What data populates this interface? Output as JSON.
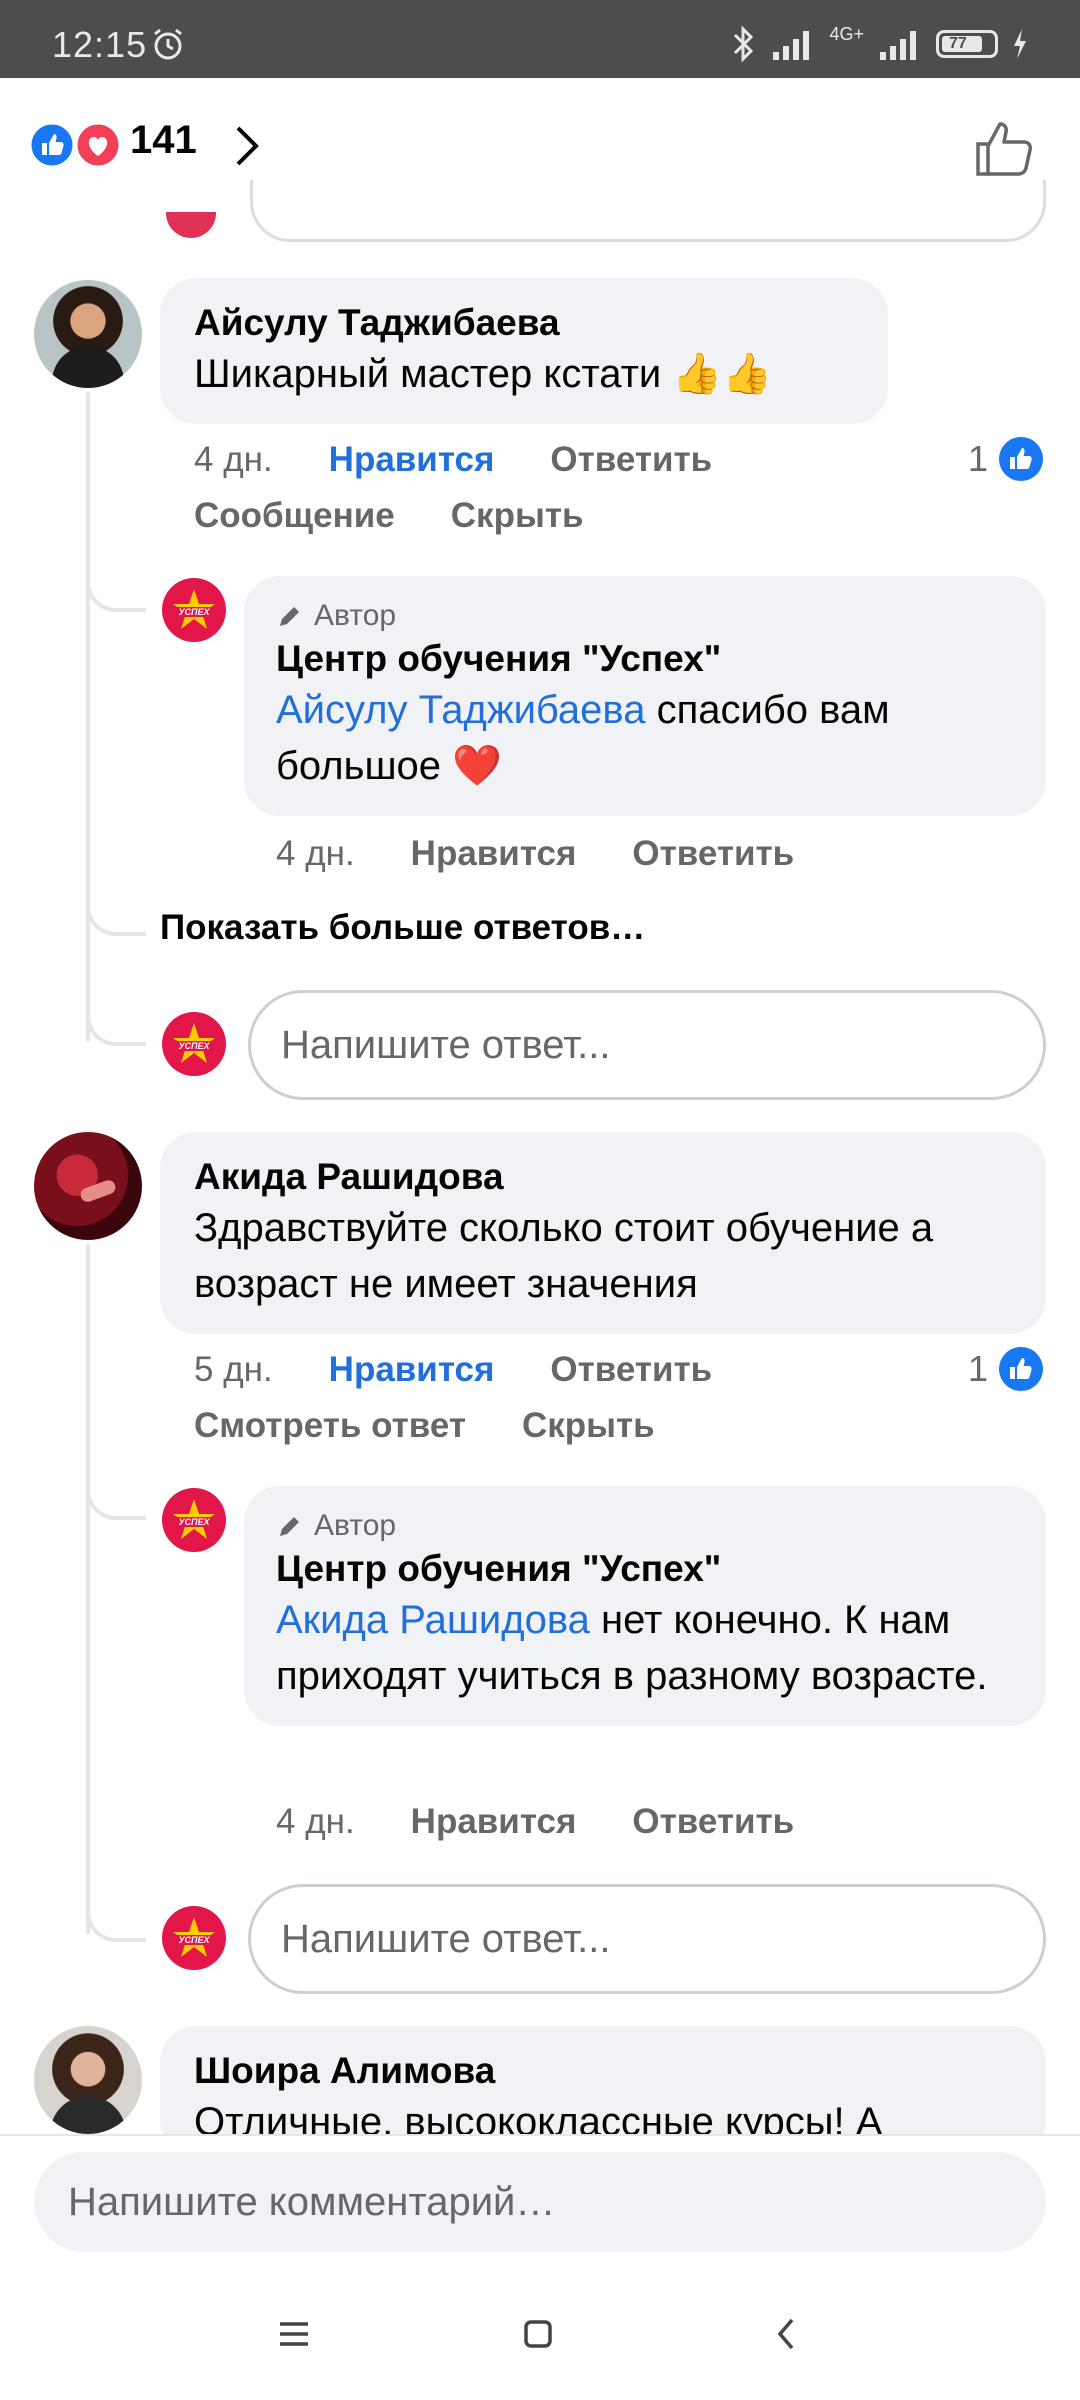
{
  "status_bar": {
    "time": "12:15",
    "network": "4G+",
    "battery": "77"
  },
  "header": {
    "reaction_count": "141"
  },
  "comments": [
    {
      "author": "Айсулу Таджибаева",
      "text": "Шикарный мастер кстати 👍👍",
      "age": "4 дн.",
      "like_label": "Нравится",
      "reply_label": "Ответить",
      "like_count": "1",
      "extra_actions": [
        "Сообщение",
        "Скрыть"
      ],
      "replies": [
        {
          "badge": "Автор",
          "author": "Центр обучения \"Успех\"",
          "mention": "Айсулу Таджибаева",
          "text": " спасибо вам большое ❤️",
          "age": "4 дн.",
          "like_label": "Нравится",
          "reply_label": "Ответить"
        }
      ],
      "more_replies": "Показать больше ответов…",
      "reply_placeholder": "Напишите ответ..."
    },
    {
      "author": "Акида Рашидова",
      "text": "Здравствуйте сколько стоит обучение а возраст не имеет значения",
      "age": "5 дн.",
      "like_label": "Нравится",
      "reply_label": "Ответить",
      "like_count": "1",
      "extra_actions": [
        "Смотреть ответ",
        "Скрыть"
      ],
      "replies": [
        {
          "badge": "Автор",
          "author": "Центр обучения \"Успех\"",
          "mention": "Акида Рашидова",
          "text": " нет конечно. К нам приходят учиться в разному возрасте.",
          "age": "4 дн.",
          "like_label": "Нравится",
          "reply_label": "Ответить"
        }
      ],
      "reply_placeholder": "Напишите ответ..."
    },
    {
      "author": "Шоира Алимова",
      "text": "Отличные, высококлассные курсы! А"
    }
  ],
  "bottom_bar": {
    "comment_placeholder": "Напишите комментарий…"
  },
  "colors": {
    "like_blue": "#216fdb",
    "brand_red": "#e3164a",
    "bubble_gray": "#f0f2f5"
  }
}
